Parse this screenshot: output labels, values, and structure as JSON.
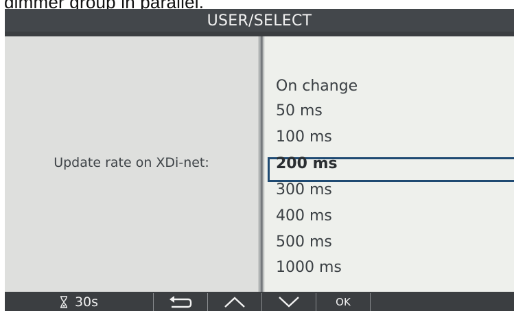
{
  "document": {
    "caption_fragment": "dimmer group in parallel."
  },
  "screen": {
    "title": "USER/SELECT",
    "setting_label": "Update rate on XDi-net:",
    "options": [
      {
        "label": "On change",
        "selected": false
      },
      {
        "label": "50 ms",
        "selected": false
      },
      {
        "label": "100 ms",
        "selected": false
      },
      {
        "label": "200 ms",
        "selected": true
      },
      {
        "label": "300 ms",
        "selected": false
      },
      {
        "label": "400 ms",
        "selected": false
      },
      {
        "label": "500 ms",
        "selected": false
      },
      {
        "label": "1000 ms",
        "selected": false
      }
    ],
    "selected_option": "200 ms"
  },
  "softkeys": {
    "timer_icon": "hourglass-icon",
    "timer_label": "30s",
    "back_icon": "back-arrow-icon",
    "up_icon": "chevron-up-icon",
    "down_icon": "chevron-down-icon",
    "ok_label": "OK"
  },
  "colors": {
    "title_bar": "#43474b",
    "left_panel": "#dedfdd",
    "list_panel": "#eef0ec",
    "selection_border": "#1f4a72",
    "bottom_bar": "#3b3e41"
  }
}
